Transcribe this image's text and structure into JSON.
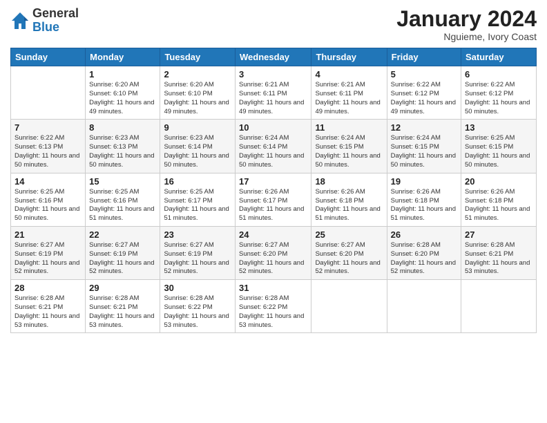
{
  "logo": {
    "general": "General",
    "blue": "Blue"
  },
  "header": {
    "month": "January 2024",
    "location": "Nguieme, Ivory Coast"
  },
  "weekdays": [
    "Sunday",
    "Monday",
    "Tuesday",
    "Wednesday",
    "Thursday",
    "Friday",
    "Saturday"
  ],
  "weeks": [
    [
      {
        "day": "",
        "info": ""
      },
      {
        "day": "1",
        "info": "Sunrise: 6:20 AM\nSunset: 6:10 PM\nDaylight: 11 hours\nand 49 minutes."
      },
      {
        "day": "2",
        "info": "Sunrise: 6:20 AM\nSunset: 6:10 PM\nDaylight: 11 hours\nand 49 minutes."
      },
      {
        "day": "3",
        "info": "Sunrise: 6:21 AM\nSunset: 6:11 PM\nDaylight: 11 hours\nand 49 minutes."
      },
      {
        "day": "4",
        "info": "Sunrise: 6:21 AM\nSunset: 6:11 PM\nDaylight: 11 hours\nand 49 minutes."
      },
      {
        "day": "5",
        "info": "Sunrise: 6:22 AM\nSunset: 6:12 PM\nDaylight: 11 hours\nand 49 minutes."
      },
      {
        "day": "6",
        "info": "Sunrise: 6:22 AM\nSunset: 6:12 PM\nDaylight: 11 hours\nand 50 minutes."
      }
    ],
    [
      {
        "day": "7",
        "info": "Sunrise: 6:22 AM\nSunset: 6:13 PM\nDaylight: 11 hours\nand 50 minutes."
      },
      {
        "day": "8",
        "info": "Sunrise: 6:23 AM\nSunset: 6:13 PM\nDaylight: 11 hours\nand 50 minutes."
      },
      {
        "day": "9",
        "info": "Sunrise: 6:23 AM\nSunset: 6:14 PM\nDaylight: 11 hours\nand 50 minutes."
      },
      {
        "day": "10",
        "info": "Sunrise: 6:24 AM\nSunset: 6:14 PM\nDaylight: 11 hours\nand 50 minutes."
      },
      {
        "day": "11",
        "info": "Sunrise: 6:24 AM\nSunset: 6:15 PM\nDaylight: 11 hours\nand 50 minutes."
      },
      {
        "day": "12",
        "info": "Sunrise: 6:24 AM\nSunset: 6:15 PM\nDaylight: 11 hours\nand 50 minutes."
      },
      {
        "day": "13",
        "info": "Sunrise: 6:25 AM\nSunset: 6:15 PM\nDaylight: 11 hours\nand 50 minutes."
      }
    ],
    [
      {
        "day": "14",
        "info": "Sunrise: 6:25 AM\nSunset: 6:16 PM\nDaylight: 11 hours\nand 50 minutes."
      },
      {
        "day": "15",
        "info": "Sunrise: 6:25 AM\nSunset: 6:16 PM\nDaylight: 11 hours\nand 51 minutes."
      },
      {
        "day": "16",
        "info": "Sunrise: 6:25 AM\nSunset: 6:17 PM\nDaylight: 11 hours\nand 51 minutes."
      },
      {
        "day": "17",
        "info": "Sunrise: 6:26 AM\nSunset: 6:17 PM\nDaylight: 11 hours\nand 51 minutes."
      },
      {
        "day": "18",
        "info": "Sunrise: 6:26 AM\nSunset: 6:18 PM\nDaylight: 11 hours\nand 51 minutes."
      },
      {
        "day": "19",
        "info": "Sunrise: 6:26 AM\nSunset: 6:18 PM\nDaylight: 11 hours\nand 51 minutes."
      },
      {
        "day": "20",
        "info": "Sunrise: 6:26 AM\nSunset: 6:18 PM\nDaylight: 11 hours\nand 51 minutes."
      }
    ],
    [
      {
        "day": "21",
        "info": "Sunrise: 6:27 AM\nSunset: 6:19 PM\nDaylight: 11 hours\nand 52 minutes."
      },
      {
        "day": "22",
        "info": "Sunrise: 6:27 AM\nSunset: 6:19 PM\nDaylight: 11 hours\nand 52 minutes."
      },
      {
        "day": "23",
        "info": "Sunrise: 6:27 AM\nSunset: 6:19 PM\nDaylight: 11 hours\nand 52 minutes."
      },
      {
        "day": "24",
        "info": "Sunrise: 6:27 AM\nSunset: 6:20 PM\nDaylight: 11 hours\nand 52 minutes."
      },
      {
        "day": "25",
        "info": "Sunrise: 6:27 AM\nSunset: 6:20 PM\nDaylight: 11 hours\nand 52 minutes."
      },
      {
        "day": "26",
        "info": "Sunrise: 6:28 AM\nSunset: 6:20 PM\nDaylight: 11 hours\nand 52 minutes."
      },
      {
        "day": "27",
        "info": "Sunrise: 6:28 AM\nSunset: 6:21 PM\nDaylight: 11 hours\nand 53 minutes."
      }
    ],
    [
      {
        "day": "28",
        "info": "Sunrise: 6:28 AM\nSunset: 6:21 PM\nDaylight: 11 hours\nand 53 minutes."
      },
      {
        "day": "29",
        "info": "Sunrise: 6:28 AM\nSunset: 6:21 PM\nDaylight: 11 hours\nand 53 minutes."
      },
      {
        "day": "30",
        "info": "Sunrise: 6:28 AM\nSunset: 6:22 PM\nDaylight: 11 hours\nand 53 minutes."
      },
      {
        "day": "31",
        "info": "Sunrise: 6:28 AM\nSunset: 6:22 PM\nDaylight: 11 hours\nand 53 minutes."
      },
      {
        "day": "",
        "info": ""
      },
      {
        "day": "",
        "info": ""
      },
      {
        "day": "",
        "info": ""
      }
    ]
  ]
}
